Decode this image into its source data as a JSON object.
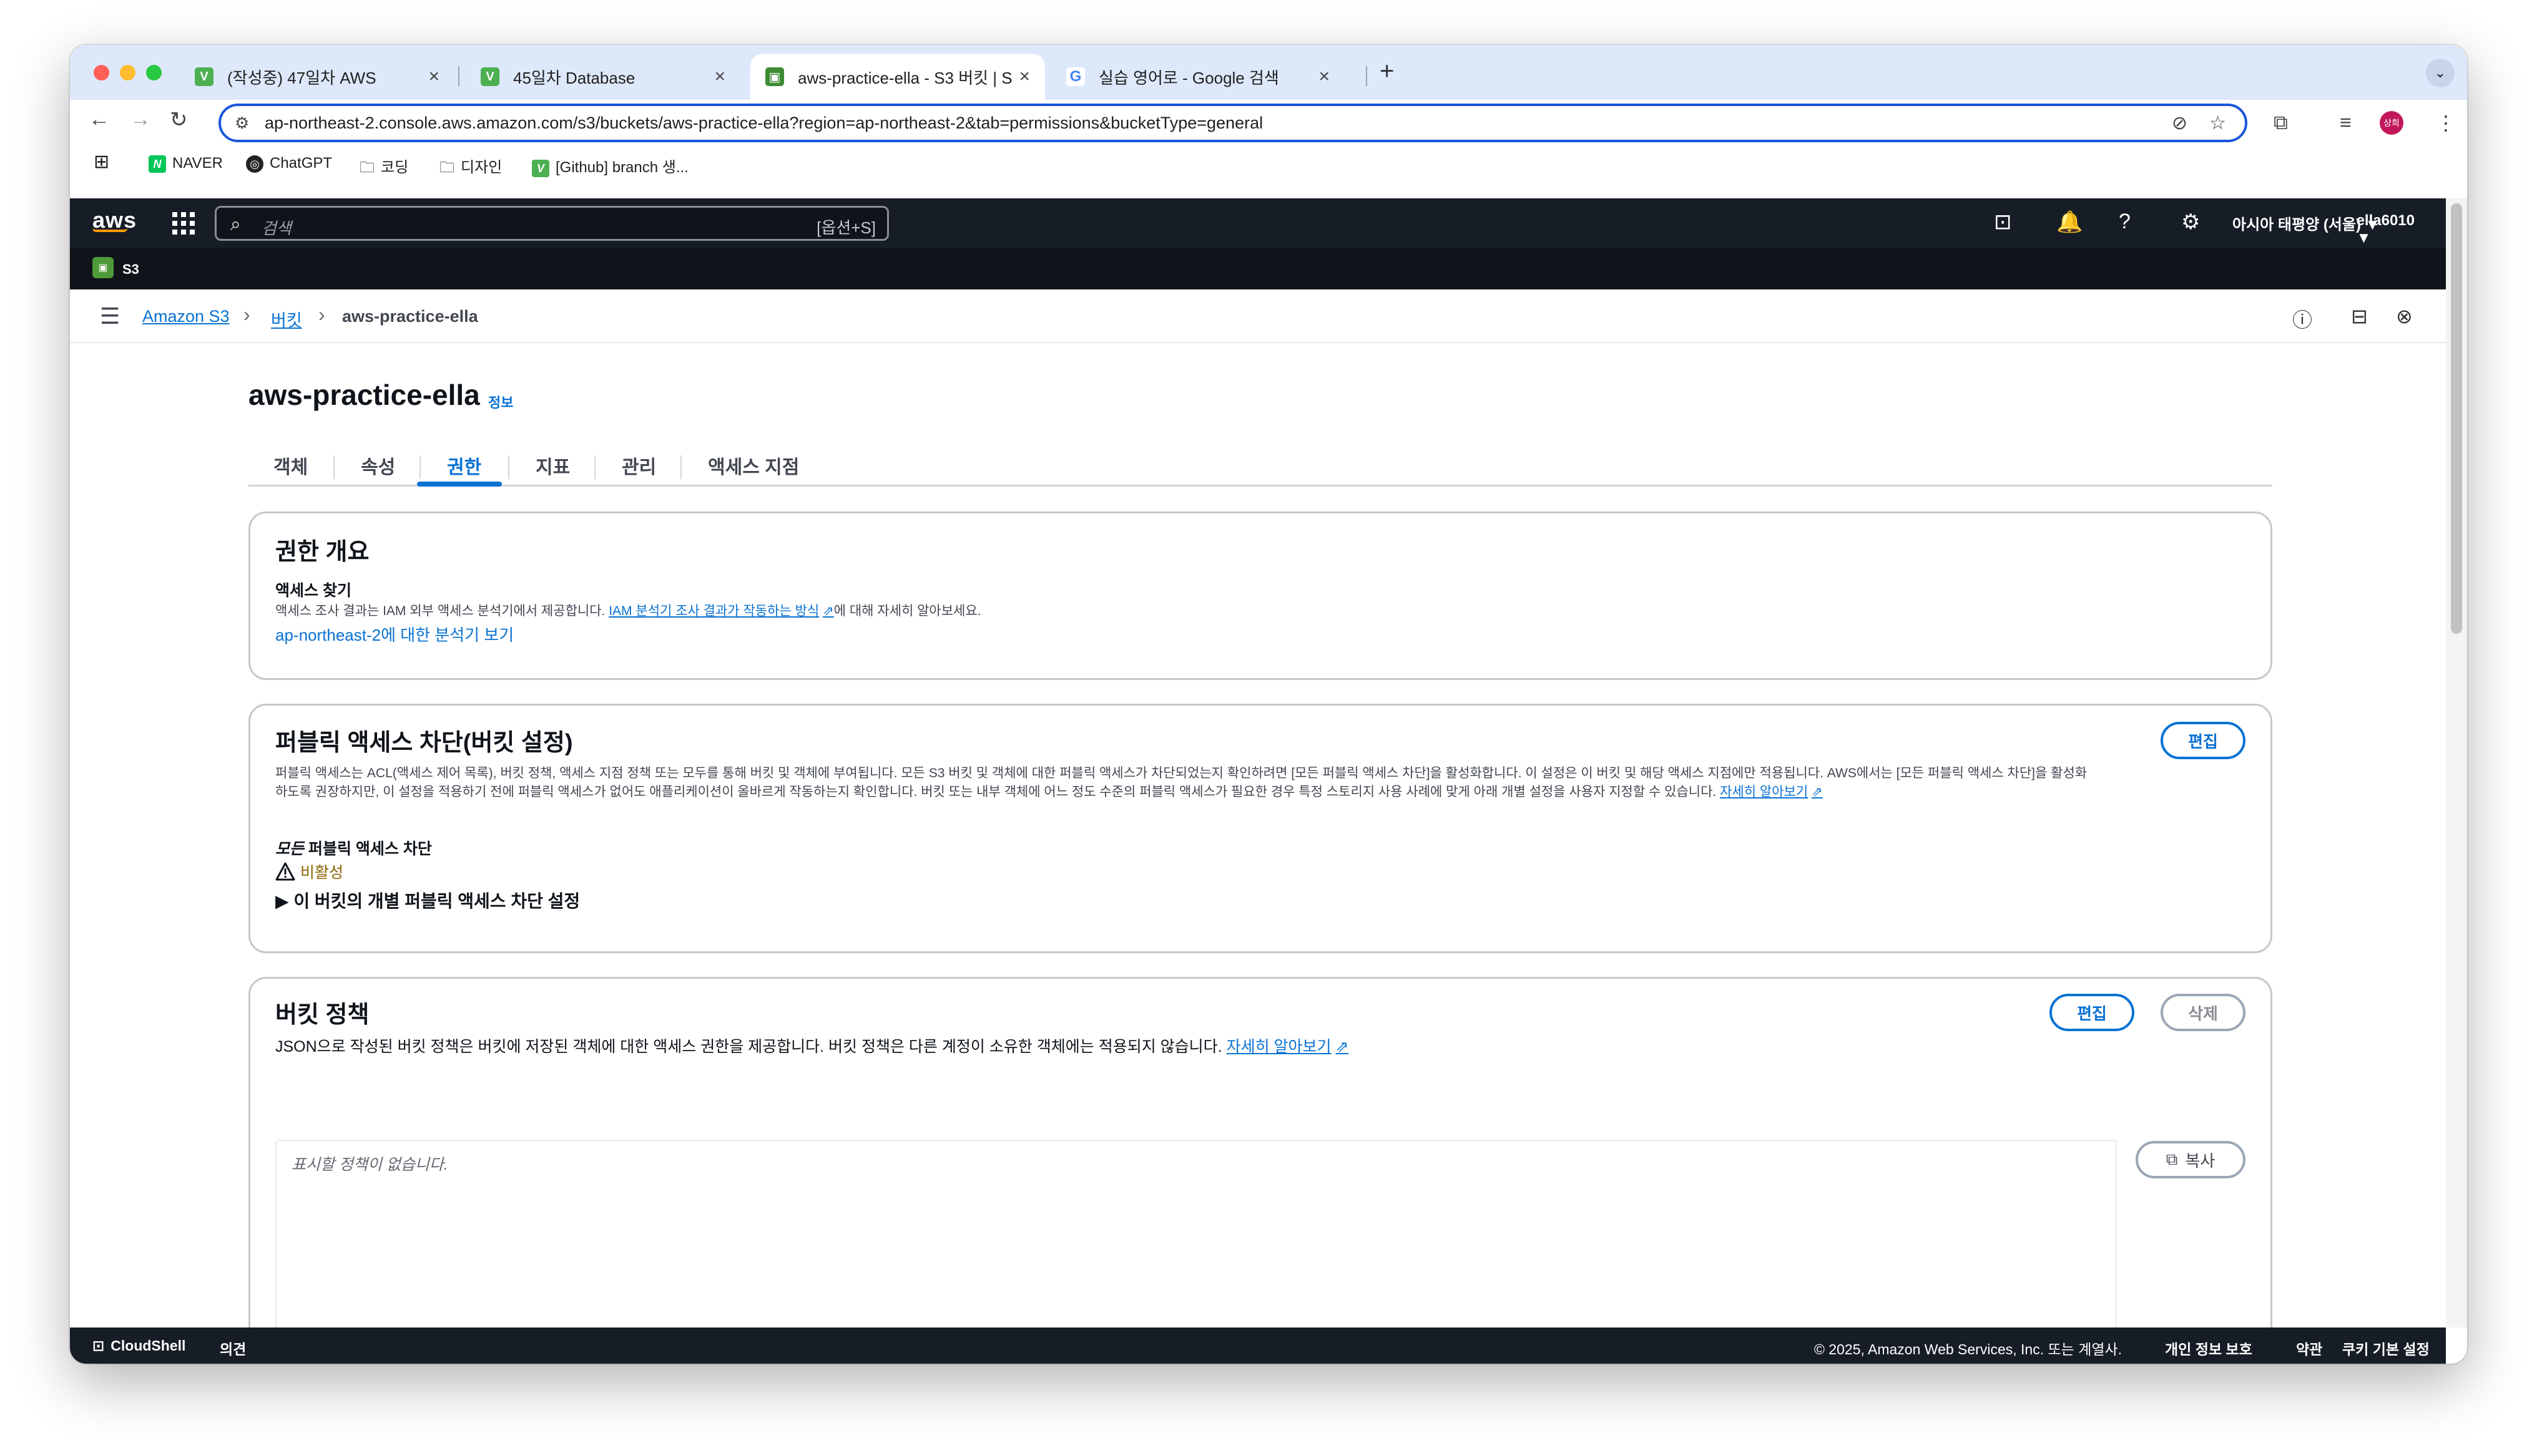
{
  "browser": {
    "tabs": [
      {
        "title": "(작성중) 47일차 AWS",
        "icon": "v-icon"
      },
      {
        "title": "45일차 Database",
        "icon": "v-icon"
      },
      {
        "title": "aws-practice-ella - S3 버킷 | S",
        "icon": "s3-icon"
      },
      {
        "title": "실습 영어로 - Google 검색",
        "icon": "google-icon"
      }
    ],
    "url": "ap-northeast-2.console.aws.amazon.com/s3/buckets/aws-practice-ella?region=ap-northeast-2&tab=permissions&bucketType=general",
    "profile": "상희",
    "bookmarks": [
      "NAVER",
      "ChatGPT",
      "코딩",
      "디자인",
      "[Github] branch 생..."
    ]
  },
  "aws": {
    "search_placeholder": "검색",
    "search_shortcut": "[옵션+S]",
    "region": "아시아 태평양 (서울) ▼",
    "account": "ella6010 ▼",
    "service": "S3"
  },
  "breadcrumb": {
    "root": "Amazon S3",
    "mid": "버킷",
    "current": "aws-practice-ella"
  },
  "page": {
    "title": "aws-practice-ella",
    "info": "정보",
    "tabs": [
      "객체",
      "속성",
      "권한",
      "지표",
      "관리",
      "액세스 지점"
    ]
  },
  "overview": {
    "title": "권한 개요",
    "subtitle": "액세스 찾기",
    "desc_prefix": "액세스 조사 결과는 IAM 외부 액세스 분석기에서 제공합니다.",
    "desc_link": "IAM 분석기 조사 결과가 작동하는 방식",
    "desc_suffix": "에 대해 자세히 알아보세요.",
    "analyzer_link": "ap-northeast-2에 대한 분석기 보기"
  },
  "public_access": {
    "title": "퍼블릭 액세스 차단(버킷 설정)",
    "edit": "편집",
    "desc1": "퍼블릭 액세스는 ACL(액세스 제어 목록), 버킷 정책, 액세스 지점 정책 또는 모두를 통해 버킷 및 객체에 부여됩니다. 모든 S3 버킷 및 객체에 대한 퍼블릭 액세스가 차단되었는지 확인하려면 [모든 퍼블릭 액세스 차단]을 활성화합니다. 이 설정은 이 버킷 및 해당 액세스 지점에만 적용됩니다. AWS에서는 [모든 퍼블릭 액세스 차단]을 활성화",
    "desc2": "하도록 권장하지만, 이 설정을 적용하기 전에 퍼블릭 액세스가 없어도 애플리케이션이 올바르게 작동하는지 확인합니다. 버킷 또는 내부 객체에 어느 정도 수준의 퍼블릭 액세스가 필요한 경우 특정 스토리지 사용 사례에 맞게 아래 개별 설정을 사용자 지정할 수 있습니다.",
    "learn_more": "자세히 알아보기",
    "block_all_em": "모든",
    "block_all_rest": " 퍼블릭 액세스 차단",
    "status": "비활성",
    "expander": "▶  이 버킷의 개별 퍼블릭 액세스 차단 설정"
  },
  "bucket_policy": {
    "title": "버킷 정책",
    "edit": "편집",
    "delete": "삭제",
    "desc": "JSON으로 작성된 버킷 정책은 버킷에 저장된 객체에 대한 액세스 권한을 제공합니다. 버킷 정책은 다른 계정이 소유한 객체에는 적용되지 않습니다.",
    "learn_more": "자세히 알아보기",
    "empty": "표시할 정책이 없습니다.",
    "copy": "복사"
  },
  "footer": {
    "cloudshell": "CloudShell",
    "feedback": "의견",
    "copyright": "© 2025, Amazon Web Services, Inc. 또는 계열사.",
    "privacy": "개인 정보 보호",
    "terms": "약관",
    "cookies": "쿠키 기본 설정"
  },
  "colors": {
    "aws_nav": "#161d26",
    "link": "#0972d3",
    "warning": "#8d6605",
    "active_tab": "#0972d3"
  }
}
